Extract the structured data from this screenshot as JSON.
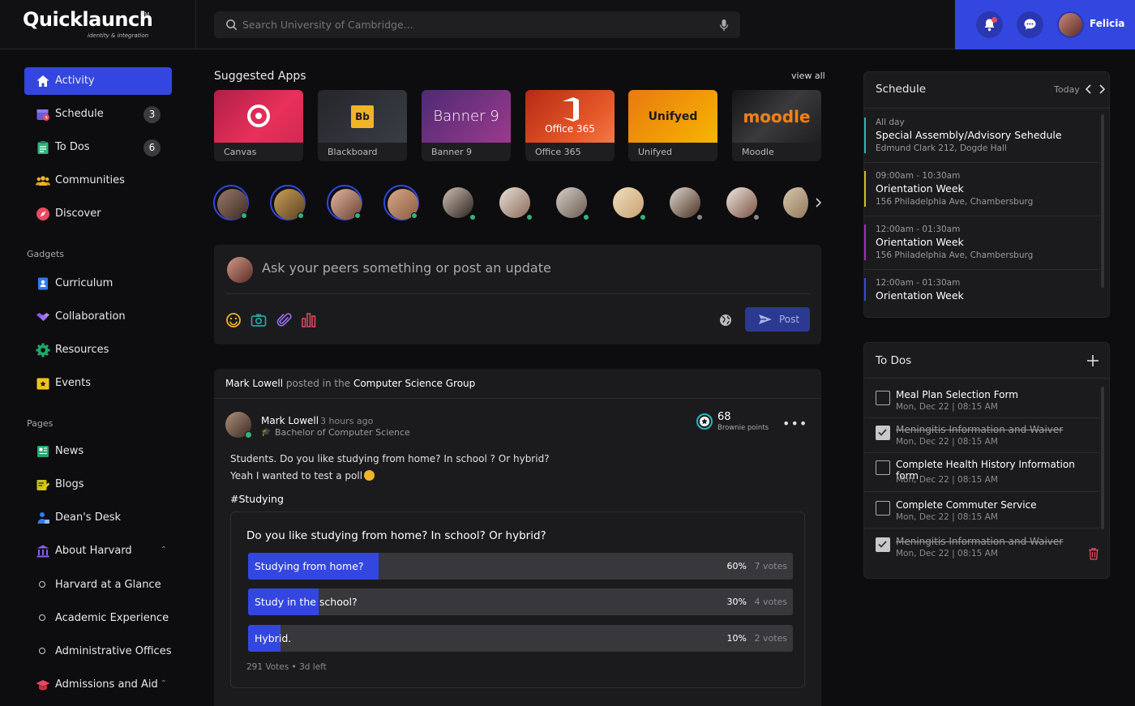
{
  "brand": {
    "name": "Quicklaunch",
    "tm": "TM",
    "tagline": "identity & integration"
  },
  "search": {
    "placeholder": "Search University of Cambridge..."
  },
  "user": {
    "name": "Felicia"
  },
  "sidebar": {
    "main": [
      {
        "label": "Activity",
        "icon": "home-icon",
        "active": true
      },
      {
        "label": "Schedule",
        "icon": "calendar-icon",
        "badge": "3"
      },
      {
        "label": "To Dos",
        "icon": "clipboard-icon",
        "badge": "6"
      },
      {
        "label": "Communities",
        "icon": "people-icon"
      },
      {
        "label": "Discover",
        "icon": "compass-icon"
      }
    ],
    "gadgets_label": "Gadgets",
    "gadgets": [
      {
        "label": "Curriculum",
        "icon": "person-book-icon"
      },
      {
        "label": "Collaboration",
        "icon": "handshake-icon"
      },
      {
        "label": "Resources",
        "icon": "gear-icon"
      },
      {
        "label": "Events",
        "icon": "star-calendar-icon"
      }
    ],
    "pages_label": "Pages",
    "pages": [
      {
        "label": "News",
        "icon": "newspaper-icon"
      },
      {
        "label": "Blogs",
        "icon": "pencil-note-icon"
      },
      {
        "label": "Dean's Desk",
        "icon": "person-desk-icon"
      },
      {
        "label": "About Harvard",
        "icon": "institution-icon"
      },
      {
        "label": "Harvard at a Glance"
      },
      {
        "label": "Academic Experience"
      },
      {
        "label": "Administrative Offices"
      },
      {
        "label": "Admissions and Aid",
        "icon": "graduation-cap-icon"
      }
    ]
  },
  "suggested": {
    "title": "Suggested Apps",
    "view_all": "view all",
    "apps": [
      {
        "label": "Canvas",
        "color1": "#c3264d",
        "color2": "#e8305a"
      },
      {
        "label": "Blackboard",
        "color1": "#2a2d33",
        "color2": "#3a3d44"
      },
      {
        "label": "Banner 9",
        "title": "Banner 9",
        "color1": "#5a2a7a",
        "color2": "#9b3a8c"
      },
      {
        "label": "Office 365",
        "title": "Office 365",
        "color1": "#c53318",
        "color2": "#e85a2a"
      },
      {
        "label": "Unifyed",
        "title": "Unifyed",
        "color1": "#e87a10",
        "color2": "#f7b500"
      },
      {
        "label": "Moodle",
        "title": "moodle",
        "color1": "#1e1e20",
        "color2": "#3a3a3d"
      }
    ]
  },
  "composer": {
    "placeholder": "Ask your peers something or post an update",
    "post_label": "Post"
  },
  "feed": {
    "author": "Mark Lowell",
    "posted_in": "posted in the",
    "group": "Computer Science Group",
    "time": "3 hours ago",
    "degree": "Bachelor of Computer Science",
    "points": "68",
    "points_label": "Brownie points",
    "text1": "Students. Do you like studying from home? In school ? Or hybrid?",
    "text2": "Yeah I wanted to test a poll",
    "hashtag": "#Studying",
    "poll": {
      "question": "Do you like studying from home? In school? Or hybrid?",
      "options": [
        {
          "label": "Studying from home?",
          "percent": "60%",
          "votes": "7 votes",
          "fill": 0.24
        },
        {
          "label": "Study in the school?",
          "percent": "30%",
          "votes": "4 votes",
          "fill": 0.13
        },
        {
          "label": "Hybrid.",
          "percent": "10%",
          "votes": "2 votes",
          "fill": 0.06
        }
      ],
      "total": "291 Votes",
      "left": "3d left"
    }
  },
  "schedule": {
    "title": "Schedule",
    "today": "Today",
    "items": [
      {
        "time": "All day",
        "title": "Special Assembly/Advisory Sehedule",
        "location": "Edmund Clark 212, Dogde Hall",
        "color": "#2bb3c4"
      },
      {
        "time": "09:00am - 10:30am",
        "title": "Orientation Week",
        "location": "156 Philadelphia Ave, Chambersburg",
        "color": "#c9c414"
      },
      {
        "time": "12:00am - 01:30am",
        "title": "Orientation Week",
        "location": "156 Philadelphia Ave, Chambersburg",
        "color": "#a42bc4"
      },
      {
        "time": "12:00am - 01:30am",
        "title": "Orientation Week",
        "location": "",
        "color": "#3347e0"
      }
    ]
  },
  "todos": {
    "title": "To Dos",
    "items": [
      {
        "title": "Meal Plan Selection Form",
        "date": "Mon, Dec 22  |  08:15 AM",
        "done": false
      },
      {
        "title": "Meningitis Information and Waiver",
        "date": "Mon, Dec 22  |  08:15 AM",
        "done": true
      },
      {
        "title": "Complete Health History Information form",
        "date": "Mon, Dec 22  |  08:15 AM",
        "done": false
      },
      {
        "title": "Complete Commuter Service",
        "date": "Mon, Dec 22  |  08:15 AM",
        "done": false
      },
      {
        "title": "Meningitis Information and Waiver",
        "date": "Mon, Dec 22  |  08:15 AM",
        "done": true
      }
    ]
  }
}
